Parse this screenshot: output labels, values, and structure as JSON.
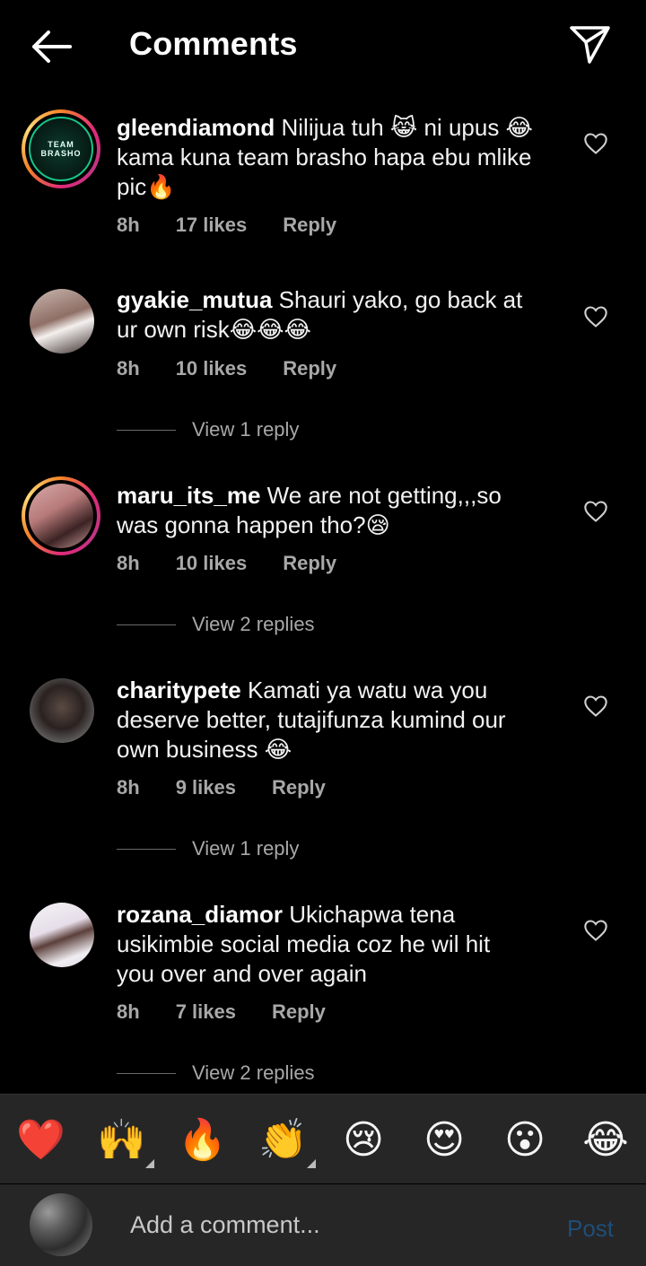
{
  "header": {
    "title": "Comments"
  },
  "comments": [
    {
      "username": "gleendiamond",
      "text_lines": [
        "Nilijua tuh 😹 ni upus 😂",
        "kama kuna team brasho hapa ebu mlike",
        "pic🔥"
      ],
      "time": "8h",
      "likes": "17 likes",
      "reply": "Reply",
      "avatar_text": [
        "TEAM",
        "BRASHO"
      ]
    },
    {
      "username": "gyakie_mutua",
      "text_lines": [
        "Shauri yako, go back at",
        "ur own risk😂😂😂"
      ],
      "time": "8h",
      "likes": "10 likes",
      "reply": "Reply",
      "view_replies": "View 1 reply"
    },
    {
      "username": "maru_its_me",
      "text_lines": [
        "We are not getting,,,so",
        "was gonna happen tho?😪"
      ],
      "time": "8h",
      "likes": "10 likes",
      "reply": "Reply",
      "view_replies": "View 2 replies"
    },
    {
      "username": "charitypete",
      "text_lines": [
        "Kamati ya watu wa you",
        "deserve better, tutajifunza kumind our",
        "own business 😂"
      ],
      "time": "8h",
      "likes": "9 likes",
      "reply": "Reply",
      "view_replies": "View 1 reply"
    },
    {
      "username": "rozana_diamor",
      "text_lines": [
        "Ukichapwa tena",
        "usikimbie social media coz he wil hit",
        "you over and over again"
      ],
      "time": "8h",
      "likes": "7 likes",
      "reply": "Reply",
      "view_replies": "View 2 replies"
    }
  ],
  "emoji_bar": [
    "❤️",
    "🙌",
    "🔥",
    "👏",
    "😢",
    "😍",
    "😮",
    "😂"
  ],
  "compose": {
    "placeholder": "Add a comment...",
    "post_label": "Post"
  },
  "icons": {
    "back": "back-arrow-icon",
    "send": "paper-plane-icon",
    "like": "heart-outline-icon"
  },
  "colors": {
    "background": "#000000",
    "bar_background": "#262626",
    "post_disabled": "#1f4e78",
    "secondary_text": "#a8a8a8"
  }
}
